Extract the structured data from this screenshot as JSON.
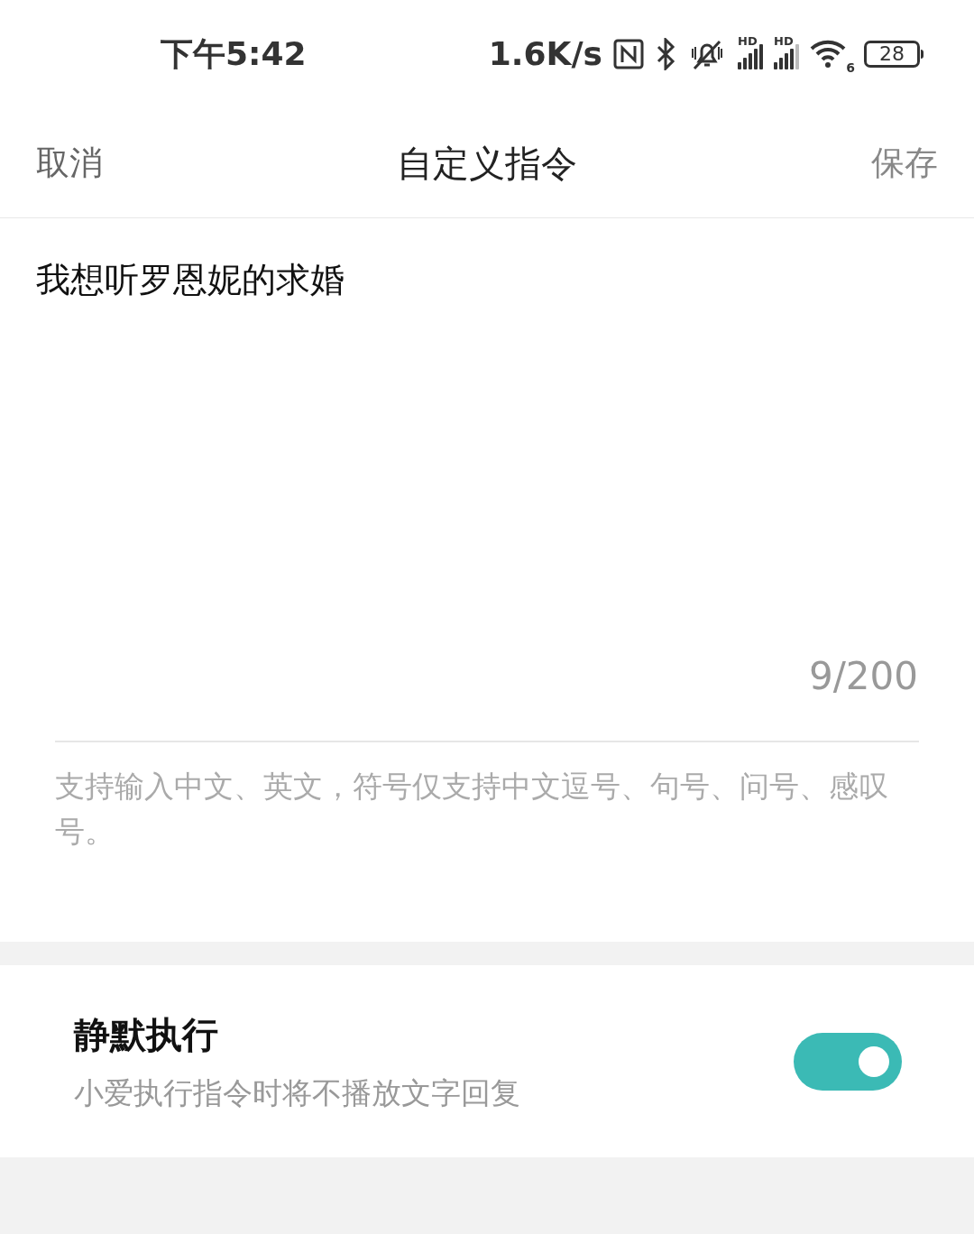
{
  "status_bar": {
    "time": "下午5:42",
    "speed": "1.6K/s",
    "signal_1_label": "HD",
    "signal_2_label": "HD",
    "wifi_label": "6",
    "battery": "28"
  },
  "header": {
    "cancel": "取消",
    "title": "自定义指令",
    "save": "保存"
  },
  "command": {
    "value": "我想听罗恩妮的求婚",
    "counter": "9/200",
    "hint": "支持输入中文、英文，符号仅支持中文逗号、句号、问号、感叹号。"
  },
  "silent": {
    "title": "静默执行",
    "description": "小爱执行指令时将不播放文字回复",
    "on": true
  }
}
